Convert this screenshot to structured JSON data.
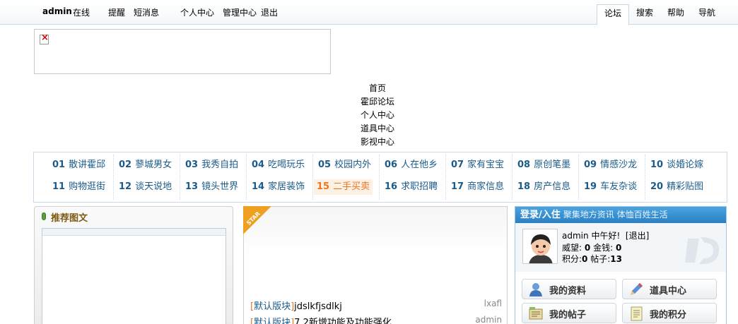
{
  "topbar": {
    "username": "admin",
    "online_status": "在线",
    "links": [
      {
        "label": "提醒"
      },
      {
        "label": "短消息"
      },
      {
        "label": "个人中心"
      },
      {
        "label": "管理中心"
      },
      {
        "label": "退出"
      }
    ],
    "tabs": [
      {
        "label": "论坛",
        "active": true
      },
      {
        "label": "搜索"
      },
      {
        "label": "帮助"
      },
      {
        "label": "导航"
      }
    ]
  },
  "banner": {
    "icon": "broken-image-icon"
  },
  "center_links": [
    "首页",
    "霍邱论坛",
    "个人中心",
    "道具中心",
    "影视中心"
  ],
  "boards": [
    {
      "num": "01",
      "name": "散讲霍邱"
    },
    {
      "num": "02",
      "name": "蓼城男女"
    },
    {
      "num": "03",
      "name": "我秀自拍"
    },
    {
      "num": "04",
      "name": "吃喝玩乐"
    },
    {
      "num": "05",
      "name": "校园内外"
    },
    {
      "num": "06",
      "name": "人在他乡"
    },
    {
      "num": "07",
      "name": "家有宝宝"
    },
    {
      "num": "08",
      "name": "原创笔墨"
    },
    {
      "num": "09",
      "name": "情感沙龙"
    },
    {
      "num": "10",
      "name": "谈婚论嫁"
    },
    {
      "num": "11",
      "name": "购物逛街"
    },
    {
      "num": "12",
      "name": "谈天说地"
    },
    {
      "num": "13",
      "name": "镜头世界"
    },
    {
      "num": "14",
      "name": "家居装饰"
    },
    {
      "num": "15",
      "name": "二手买卖",
      "highlight": true
    },
    {
      "num": "16",
      "name": "求职招聘"
    },
    {
      "num": "17",
      "name": "商家信息"
    },
    {
      "num": "18",
      "name": "房产信息"
    },
    {
      "num": "19",
      "name": "车友杂谈"
    },
    {
      "num": "20",
      "name": "精彩贴图"
    }
  ],
  "left_panel": {
    "title": "推荐图文"
  },
  "middle_panel": {
    "badge": "STAR",
    "posts": [
      {
        "category": "默认版块",
        "title": "jdslkfjsdlkj",
        "author": "lxafl"
      },
      {
        "category": "默认版块",
        "title": "7.2新增功能及功能强化",
        "author": "admin"
      }
    ]
  },
  "right_panel": {
    "title": "登录/入住",
    "subtitle": "聚集地方资讯  体恤百姓生活",
    "user": {
      "name": "admin",
      "greeting": "中午好!",
      "logout": "[退出]",
      "prestige_label": "威望:",
      "prestige": "0",
      "money_label": "金钱:",
      "money": "0",
      "points_label": "积分:",
      "points": "0",
      "posts_label": "帖子:",
      "posts": "13"
    },
    "buttons": [
      {
        "label": "我的资料",
        "icon": "user-profile-icon"
      },
      {
        "label": "道具中心",
        "icon": "pen-icon"
      },
      {
        "label": "我的帖子",
        "icon": "posts-icon"
      },
      {
        "label": "我的积分",
        "icon": "notepad-icon"
      }
    ]
  }
}
